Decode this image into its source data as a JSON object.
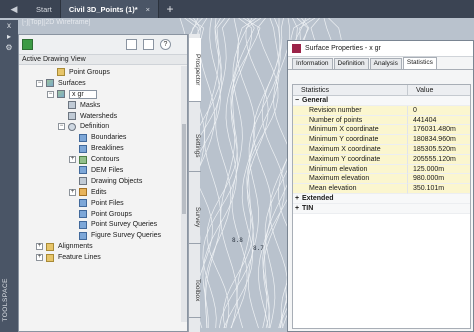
{
  "tabs": {
    "nav_left": "◀",
    "start": "Start",
    "active_doc": "Civil 3D_Points",
    "active_doc_marker": "(1)*",
    "close": "×",
    "add": "+"
  },
  "viewport": {
    "label": "[-][Top][2D Wireframe]"
  },
  "drawing_labels": [
    {
      "text": "8.8"
    },
    {
      "text": "8.7"
    }
  ],
  "toolspace": {
    "strip_buttons": [
      "x",
      "▸",
      "⚙"
    ],
    "vertical_title": "TOOLSPACE",
    "toolbar": {
      "project_icon": "project-icon",
      "window_icon": "window-icon",
      "panel_icon": "panel-icon",
      "help": "?"
    },
    "view_dropdown": "Active Drawing View",
    "tree": [
      {
        "label": "Point Groups",
        "indent": 2,
        "expand": "",
        "icon": "folder"
      },
      {
        "label": "Surfaces",
        "indent": 1,
        "expand": "−",
        "icon": "surface"
      },
      {
        "label": "x gr",
        "indent": 2,
        "expand": "−",
        "icon": "surface",
        "selected": true
      },
      {
        "label": "Masks",
        "indent": 3,
        "expand": "",
        "icon": "cube"
      },
      {
        "label": "Watersheds",
        "indent": 3,
        "expand": "",
        "icon": "cube"
      },
      {
        "label": "Definition",
        "indent": 3,
        "expand": "−",
        "icon": "def"
      },
      {
        "label": "Boundaries",
        "indent": 4,
        "expand": "",
        "icon": "blue"
      },
      {
        "label": "Breaklines",
        "indent": 4,
        "expand": "",
        "icon": "blue"
      },
      {
        "label": "Contours",
        "indent": 4,
        "expand": "+",
        "icon": "green"
      },
      {
        "label": "DEM Files",
        "indent": 4,
        "expand": "",
        "icon": "blue"
      },
      {
        "label": "Drawing Objects",
        "indent": 4,
        "expand": "",
        "icon": "cube"
      },
      {
        "label": "Edits",
        "indent": 4,
        "expand": "+",
        "icon": "orange"
      },
      {
        "label": "Point Files",
        "indent": 4,
        "expand": "",
        "icon": "blue"
      },
      {
        "label": "Point Groups",
        "indent": 4,
        "expand": "",
        "icon": "blue"
      },
      {
        "label": "Point Survey Queries",
        "indent": 4,
        "expand": "",
        "icon": "blue"
      },
      {
        "label": "Figure Survey Queries",
        "indent": 4,
        "expand": "",
        "icon": "blue"
      },
      {
        "label": "Alignments",
        "indent": 1,
        "expand": "+",
        "icon": "folder"
      },
      {
        "label": "Feature Lines",
        "indent": 1,
        "expand": "+",
        "icon": "folder"
      }
    ],
    "side_tabs": [
      "Prospector",
      "Settings",
      "Survey",
      "Toolbox"
    ]
  },
  "dialog": {
    "title": "Surface Properties - x gr",
    "tabs": [
      "Information",
      "Definition",
      "Analysis",
      "Statistics"
    ],
    "active_tab": "Statistics",
    "columns": [
      "Statistics",
      "Value"
    ],
    "groups": [
      {
        "name": "General",
        "expand": "−",
        "rows": [
          {
            "name": "Revision number",
            "value": "0"
          },
          {
            "name": "Number of points",
            "value": "441404"
          },
          {
            "name": "Minimum X coordinate",
            "value": "176031.480m"
          },
          {
            "name": "Minimum Y coordinate",
            "value": "180834.960m"
          },
          {
            "name": "Maximum X coordinate",
            "value": "185305.520m"
          },
          {
            "name": "Maximum Y coordinate",
            "value": "205555.120m"
          },
          {
            "name": "Minimum elevation",
            "value": "125.000m"
          },
          {
            "name": "Maximum elevation",
            "value": "980.000m"
          },
          {
            "name": "Mean elevation",
            "value": "350.101m"
          }
        ]
      },
      {
        "name": "Extended",
        "expand": "+",
        "rows": []
      },
      {
        "name": "TIN",
        "expand": "+",
        "rows": []
      }
    ]
  },
  "colors": {
    "tabbar": "#3b4453",
    "drawing_bg": "#b9c2cd",
    "contour": "#eef1f4",
    "highlight_row": "#fbf6cf",
    "dialog_logo": "#9b2348"
  }
}
